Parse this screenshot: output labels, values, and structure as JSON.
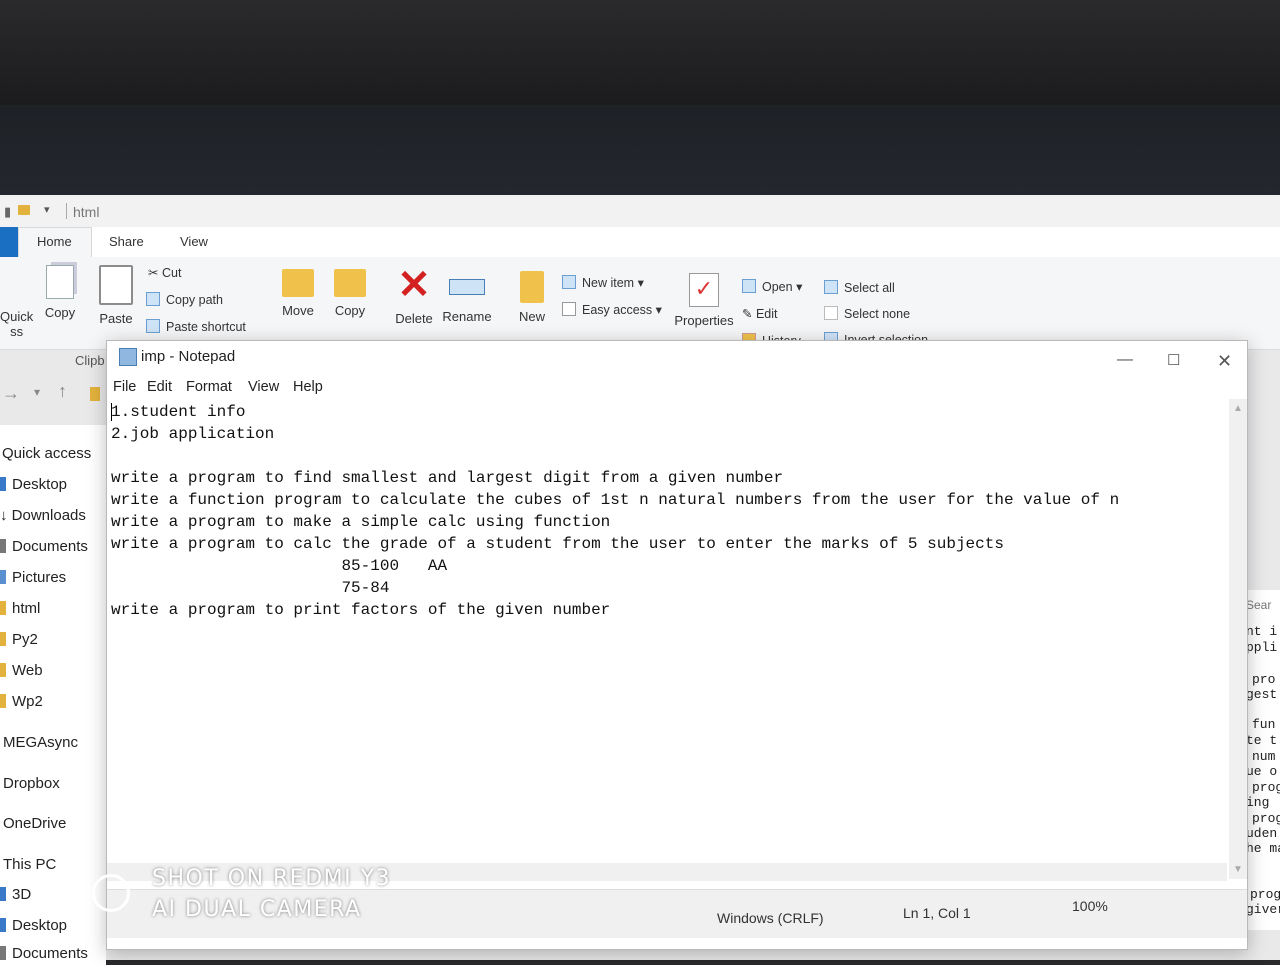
{
  "explorer": {
    "path": "html",
    "tabs": [
      "Home",
      "Share",
      "View"
    ],
    "ribbon": {
      "pin_quick_access": "Quick",
      "pin_quick_access_2": "ss",
      "copy": "Copy",
      "paste": "Paste",
      "cut": "Cut",
      "copy_path": "Copy path",
      "paste_shortcut": "Paste shortcut",
      "move": "Move",
      "copy_to": "Copy",
      "delete": "Delete",
      "rename": "Rename",
      "new_folder": "New",
      "new_item": "New item",
      "easy_access": "Easy access",
      "properties": "Properties",
      "open": "Open",
      "edit": "Edit",
      "history": "History",
      "select_all": "Select all",
      "select_none": "Select none",
      "invert_selection": "Invert selection",
      "clipboard_group": "Clipb"
    },
    "sidebar": [
      "Quick access",
      "Desktop",
      "Downloads",
      "Documents",
      "Pictures",
      "html",
      "Py2",
      "Web",
      "Wp2",
      "MEGAsync",
      "Dropbox",
      "OneDrive",
      "This PC",
      "3D",
      "Desktop",
      "Documents"
    ],
    "search_placeholder": "Sear",
    "right_fragments": [
      "nt i",
      "ppli",
      "pro",
      "gest",
      "fun",
      "te t",
      "num",
      "ue o",
      "prog",
      "ing",
      "prog",
      "uden",
      "he ma",
      "prog",
      "giver"
    ]
  },
  "notepad": {
    "title": "imp - Notepad",
    "menu": [
      "File",
      "Edit",
      "Format",
      "View",
      "Help"
    ],
    "lines": [
      "1.student info",
      "2.job application",
      "",
      "write a program to find smallest and largest digit from a given number",
      "write a function program to calculate the cubes of 1st n natural numbers from the user for the value of n",
      "write a program to make a simple calc using function",
      "write a program to calc the grade of a student from the user to enter the marks of 5 subjects",
      "                        85-100   AA",
      "                        75-84",
      "write a program to print factors of the given number"
    ],
    "status": {
      "line_ending": "Windows (CRLF)",
      "position": "Ln 1, Col 1",
      "zoom": "100%"
    }
  },
  "watermark": {
    "line1": "SHOT ON REDMI Y3",
    "line2": "AI DUAL CAMERA"
  }
}
